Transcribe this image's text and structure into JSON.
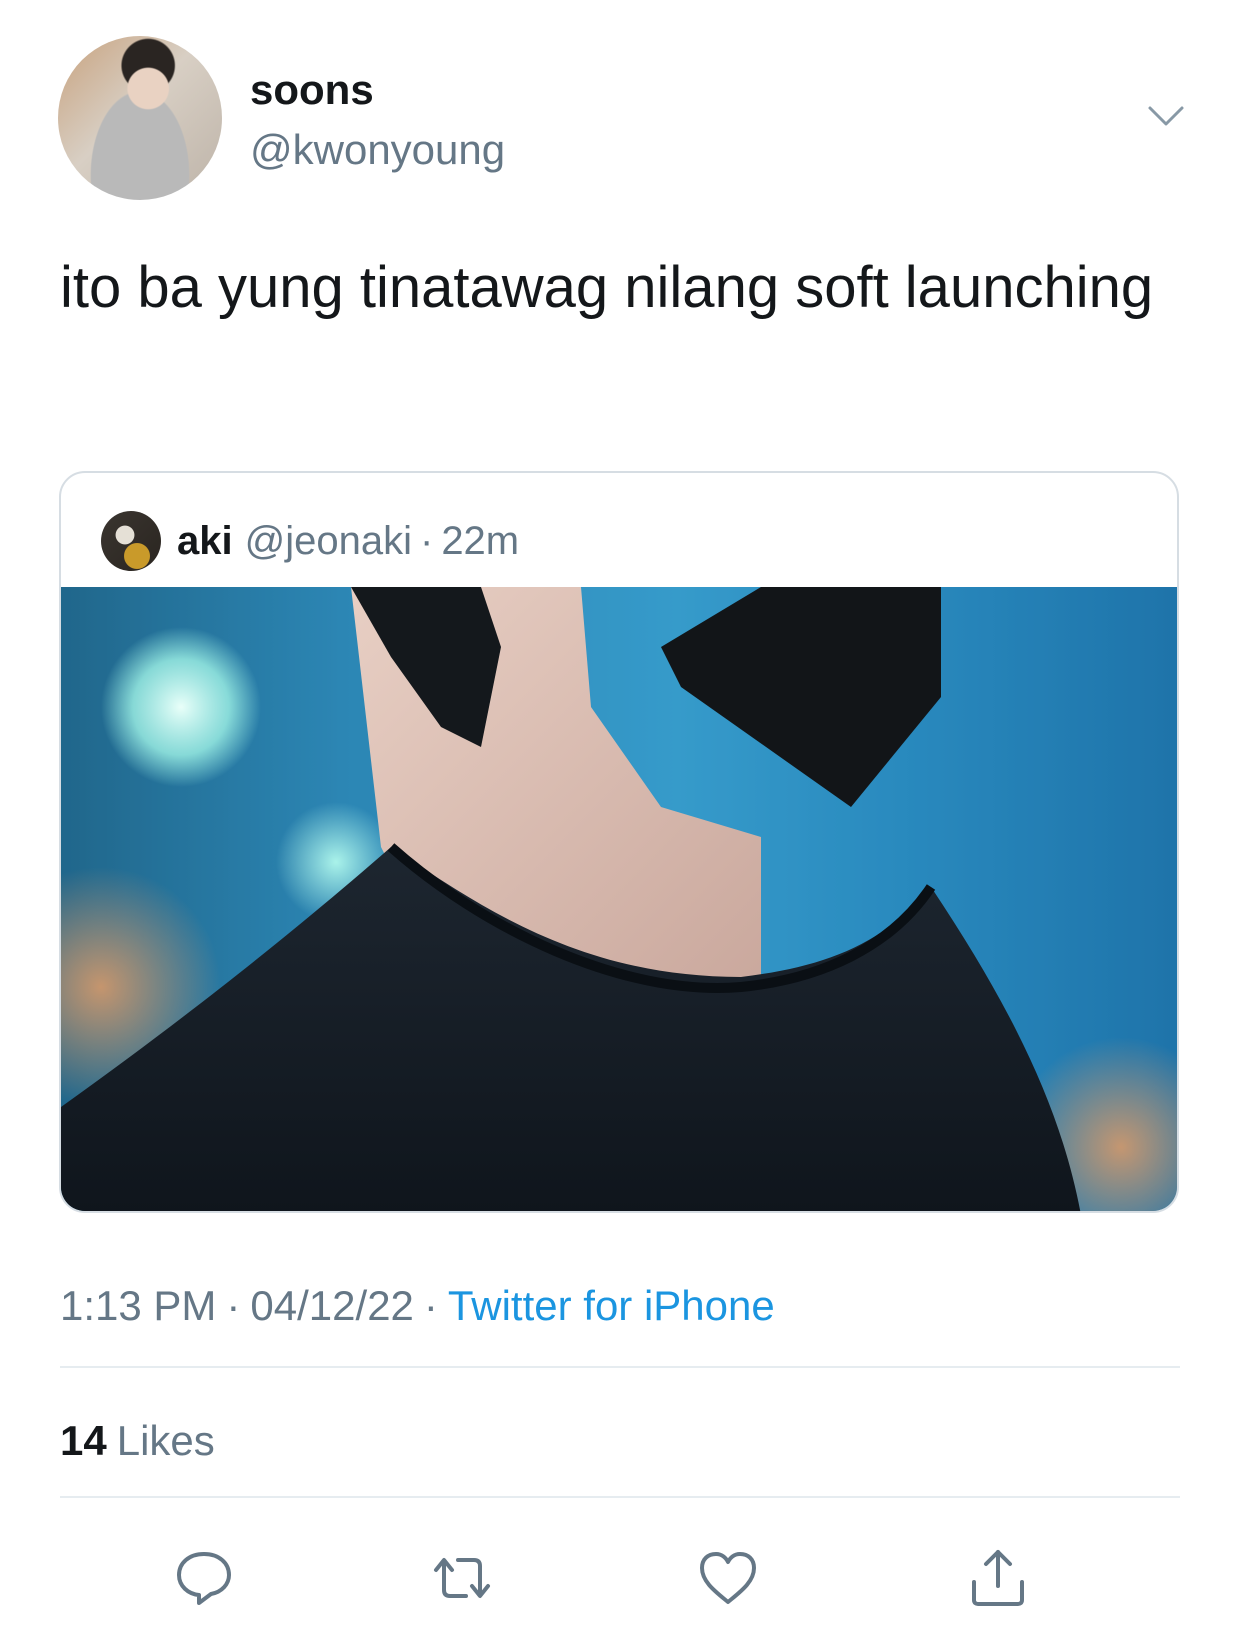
{
  "author": {
    "display_name": "soons",
    "handle": "@kwonyoung"
  },
  "tweet": {
    "text": "ito ba yung tinatawag nilang soft launching"
  },
  "quoted_tweet": {
    "display_name": "aki",
    "handle": "@jeonaki",
    "separator": "·",
    "time_ago": "22m"
  },
  "meta": {
    "time": "1:13 PM",
    "separator": "·",
    "date": "04/12/22",
    "source": "Twitter for iPhone"
  },
  "stats": {
    "likes_count": "14",
    "likes_label": "Likes"
  },
  "icons": {
    "menu": "chevron-down-icon",
    "reply": "reply-icon",
    "retweet": "retweet-icon",
    "like": "heart-icon",
    "share": "share-icon"
  },
  "colors": {
    "text": "#14171a",
    "secondary": "#657786",
    "link": "#1b95e0",
    "divider": "#e6ecf0"
  }
}
